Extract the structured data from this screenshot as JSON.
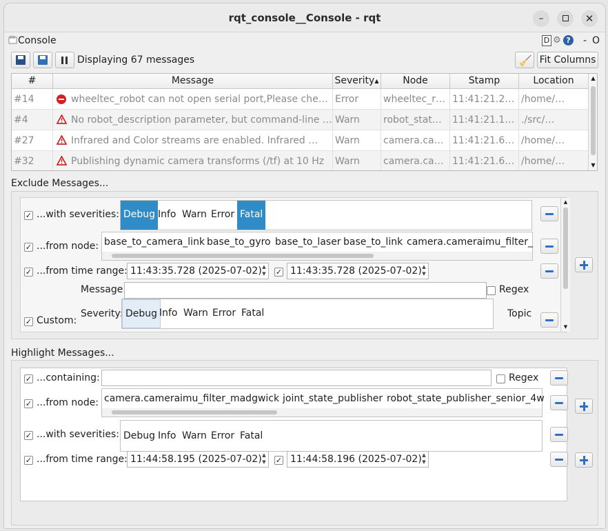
{
  "window": {
    "title": "rqt_console__Console - rqt"
  },
  "panel": {
    "title": "Console",
    "right_labels": [
      "D",
      "-",
      "O"
    ]
  },
  "toolbar": {
    "status": "Displaying 67 messages",
    "fit_columns": "Fit Columns"
  },
  "table": {
    "columns": [
      "#",
      "Message",
      "Severity",
      "Node",
      "Stamp",
      "Location"
    ],
    "rows": [
      {
        "num": "#14",
        "icon": "error-icon",
        "message": "wheeltec_robot can not open serial port,Please chec…",
        "severity": "Error",
        "node": "wheeltec_r…",
        "stamp": "11:41:21.2…",
        "location": "/home/…"
      },
      {
        "num": "#4",
        "icon": "warning-icon",
        "message": "No robot_description parameter, but command-line …",
        "severity": "Warn",
        "node": "robot_stat…",
        "stamp": "11:41:21.1…",
        "location": "./src/…"
      },
      {
        "num": "#27",
        "icon": "warning-icon",
        "message": "Infrared and Color streams are enabled. Infrared …",
        "severity": "Warn",
        "node": "camera.ca…",
        "stamp": "11:41:21.6…",
        "location": "/home/…"
      },
      {
        "num": "#32",
        "icon": "warning-icon",
        "message": "Publishing dynamic camera transforms (/tf) at 10 Hz",
        "severity": "Warn",
        "node": "camera.ca…",
        "stamp": "11:41:21.6…",
        "location": "/home/…"
      }
    ]
  },
  "exclude": {
    "title": "Exclude Messages...",
    "severities_label": "...with severities:",
    "severities": [
      "Debug",
      "Info",
      "Warn",
      "Error",
      "Fatal"
    ],
    "node_label": "...from node:",
    "nodes": [
      "base_to_camera_link",
      "base_to_gyro",
      "base_to_laser",
      "base_to_link",
      "camera.camera",
      "imu_filter_"
    ],
    "time_label": "...from time range:",
    "time_start": "11:43:35.728 (2025-07-02)",
    "time_end": "11:43:35.728 (2025-07-02)",
    "custom_label": "Custom:",
    "custom_message_label": "Message:",
    "custom_regex": "Regex",
    "custom_severity_label": "Severity:",
    "custom_severities": [
      "Debug",
      "Info",
      "Warn",
      "Error",
      "Fatal"
    ],
    "custom_topic_label": "Topic"
  },
  "highlight": {
    "title": "Highlight Messages...",
    "containing_label": "...containing:",
    "regex": "Regex",
    "node_label": "...from node:",
    "nodes": [
      "camera.camera",
      "imu_filter_madgwick",
      "joint_state_publisher",
      "robot_state_publisher_senior_4w"
    ],
    "severities_label": "...with severities:",
    "severities": [
      "Debug",
      "Info",
      "Warn",
      "Error",
      "Fatal"
    ],
    "time_label": "...from time range:",
    "time_start": "11:44:58.195 (2025-07-02)",
    "time_end": "11:44:58.196 (2025-07-02)"
  },
  "colors": {
    "selection": "#308cc6",
    "accent_blue": "#2d6ec8",
    "error_red": "#d42020",
    "warn_red": "#c62828"
  }
}
